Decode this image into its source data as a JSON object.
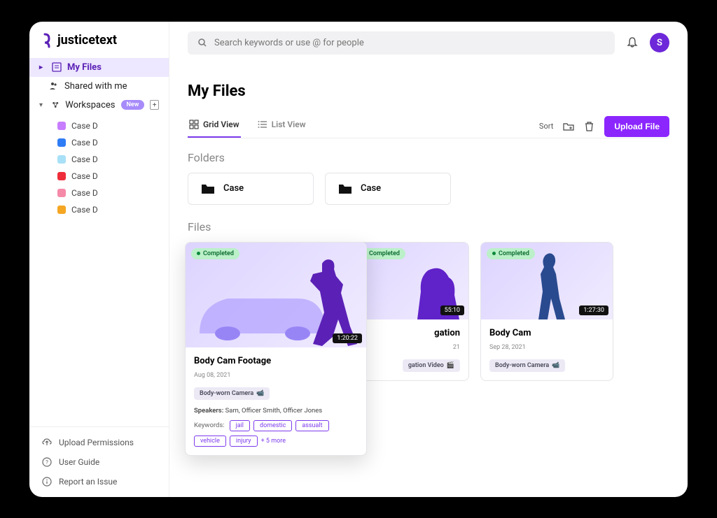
{
  "brand": "justicetext",
  "search": {
    "placeholder": "Search keywords or use @ for people"
  },
  "user": {
    "initial": "S"
  },
  "sidebar": {
    "my_files": "My Files",
    "shared": "Shared with me",
    "workspaces": "Workspaces",
    "new_badge": "New",
    "items": [
      {
        "label": "Case D",
        "color": "#c77dff"
      },
      {
        "label": "Case D",
        "color": "#2f7df6"
      },
      {
        "label": "Case D",
        "color": "#a8e0f7"
      },
      {
        "label": "Case D",
        "color": "#ef2d3a"
      },
      {
        "label": "Case D",
        "color": "#f58aa8"
      },
      {
        "label": "Case D",
        "color": "#f5a623"
      }
    ],
    "bottom": {
      "upload_perm": "Upload Permissions",
      "user_guide": "User Guide",
      "report": "Report an Issue"
    }
  },
  "page": {
    "title": "My Files"
  },
  "toolbar": {
    "grid_view": "Grid View",
    "list_view": "List View",
    "sort": "Sort",
    "upload": "Upload File"
  },
  "sections": {
    "folders": "Folders",
    "files": "Files"
  },
  "folders": [
    {
      "name": "Case"
    },
    {
      "name": "Case"
    }
  ],
  "files": {
    "featured": {
      "status": "Completed",
      "duration": "1:20:22",
      "title": "Body Cam Footage",
      "date": "Aug 08, 2021",
      "tag": "Body-worn Camera",
      "speakers_label": "Speakers:",
      "speakers": "Sam, Officer Smith, Officer Jones",
      "keywords_label": "Keywords:",
      "keywords": [
        "jail",
        "domestic",
        "assualt",
        "vehicle",
        "injury"
      ],
      "more": "+ 5 more"
    },
    "card2": {
      "status": "Completed",
      "duration": "55:10",
      "title_suffix": "gation",
      "date_suffix": "21",
      "tag_suffix": "gation Video"
    },
    "card3": {
      "status": "Completed",
      "duration": "1:27:30",
      "title": "Body Cam",
      "date": "Sep 28, 2021",
      "tag": "Body-worn Camera"
    }
  }
}
